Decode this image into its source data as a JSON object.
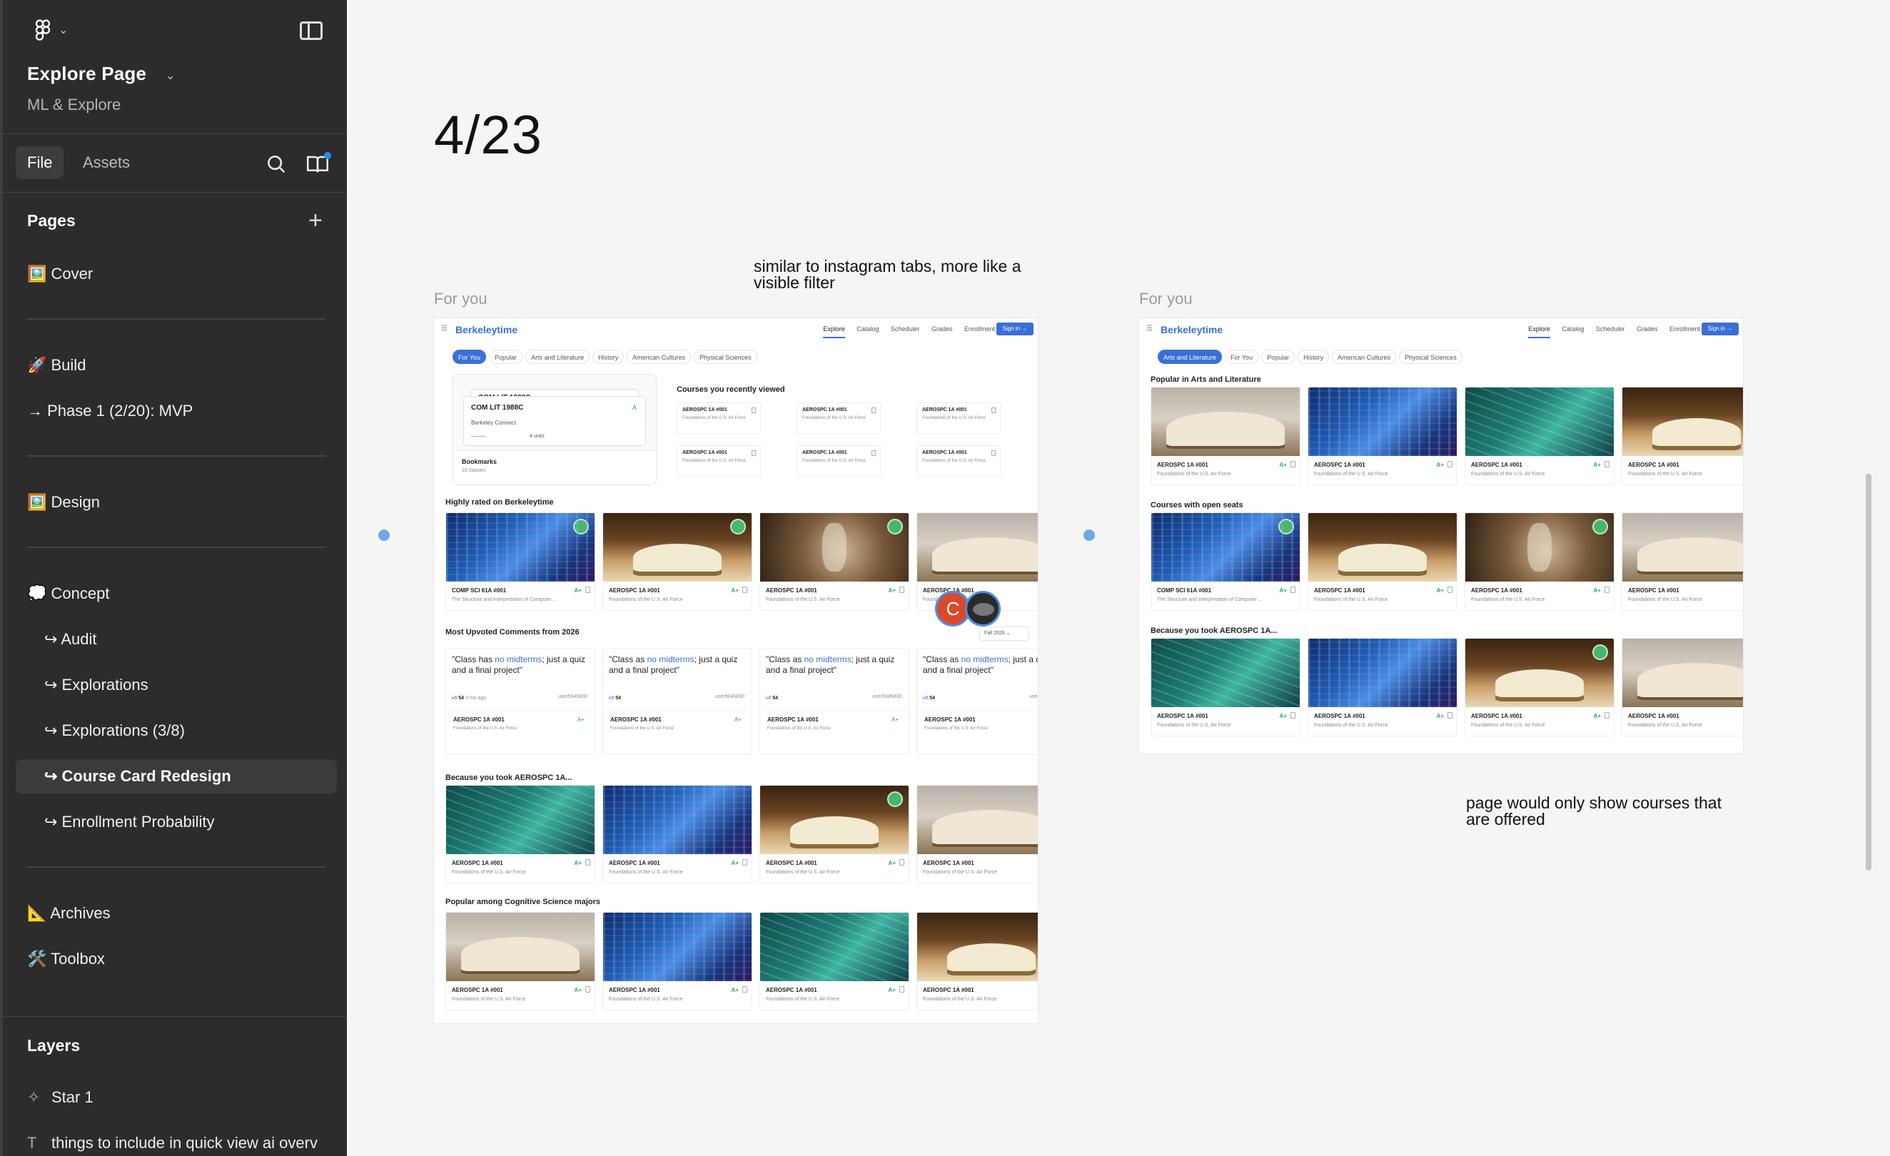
{
  "sidebar": {
    "file_title": "Explore Page",
    "file_subtitle": "ML & Explore",
    "tabs": {
      "file": "File",
      "assets": "Assets"
    },
    "pages_heading": "Pages",
    "pages": [
      {
        "label": "🖼️ Cover"
      },
      {
        "label": "🚀 Build"
      },
      {
        "label": "→ Phase 1 (2/20): MVP"
      },
      {
        "label": "🖼️ Design"
      },
      {
        "label": "💭 Concept"
      },
      {
        "label": "↪ Audit"
      },
      {
        "label": "↪ Explorations"
      },
      {
        "label": "↪ Explorations (3/8)"
      },
      {
        "label": "↪ Course Card Redesign"
      },
      {
        "label": "↪ Enrollment Probability"
      },
      {
        "label": "📐 Archives"
      },
      {
        "label": "🛠️ Toolbox"
      }
    ],
    "layers_heading": "Layers",
    "layers": [
      {
        "label": "Star 1",
        "icon": "star-icon"
      },
      {
        "label": "things to include in quick view ai overv",
        "icon": "text-icon"
      }
    ]
  },
  "canvas": {
    "date_heading": "4/23",
    "frame_label_left": "For you",
    "frame_label_right": "For you",
    "note_tabs_1": "similar to instagram tabs, more like a",
    "note_tabs_2": "visible filter",
    "note_offered_1": "page would only show courses that",
    "note_offered_2": "are offered"
  },
  "berkeleytime": {
    "brand": "Berkeleytime",
    "nav": [
      "Explore",
      "Catalog",
      "Scheduler",
      "Grades",
      "Enrollment"
    ],
    "sign_in": "Sign in  →",
    "chips_left": [
      "For You",
      "Popular",
      "Arts and Literature",
      "History",
      "American Cultures",
      "Physical Sciences"
    ],
    "chips_right": [
      "Arts and Literature",
      "For You",
      "Popular",
      "History",
      "American Cultures",
      "Physical Sciences"
    ],
    "sections_left": {
      "recent": "Courses you recently viewed",
      "rated": "Highly rated on Berkeleytime",
      "comments": "Most Upvoted Comments from 2026",
      "because": "Because you took AEROSPC 1A...",
      "popular": "Popular among Cognitive Science majors"
    },
    "sections_right": {
      "popular_arts": "Popular in Arts and Literature",
      "open_seats": "Courses with open seats",
      "because": "Because you took AEROSPC 1A..."
    },
    "bookmarks": {
      "title": "Bookmarks",
      "count": "23 classes",
      "card_title_back": "COM LIT 1988C",
      "card_title": "COM LIT 1988C",
      "card_sub": "Berkeley Connect",
      "card_grade": "A",
      "card_red": "———",
      "card_units": "4 units"
    },
    "course_code": "AEROSPC 1A #001",
    "course_sub": "Foundations of the U.S. Air Force",
    "cs_code": "COMP SCI 61A #001",
    "cs_sub": "The Structure and Interpretation of Computer ...",
    "grade": "A+",
    "semester": "Fall 2026  ⌄",
    "comment_a_pre": "\"Class has ",
    "comment_b_pre": "\"Class as ",
    "comment_hl": "no midterms",
    "comment_post": "; just a quiz and a final project\"",
    "comment_votes": "54",
    "comment_time": "3 mo ago",
    "comment_user": "user5045830"
  },
  "avatars": {
    "c_initial": "C"
  },
  "colors": {
    "accent": "#3b6fd6",
    "grade": "#2eaa5c",
    "sidebar": "#2c2c2c",
    "canvas": "#f5f5f5",
    "selection_dot": "#6ea8e6"
  }
}
